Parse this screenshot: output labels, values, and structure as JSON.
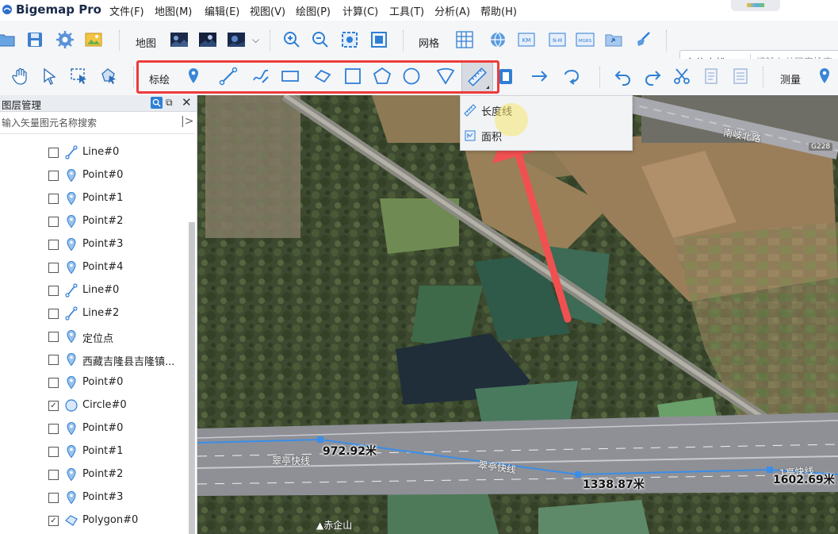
{
  "app": {
    "title": "Bigemap Pro"
  },
  "menu": [
    "文件(F)",
    "地图(M)",
    "编辑(E)",
    "视图(V)",
    "绘图(P)",
    "计算(C)",
    "工具(T)",
    "分析(A)",
    "帮助(H)"
  ],
  "toolbar1": {
    "map_label": "地图",
    "grid_label": "网格",
    "search_type": "定位查找",
    "search_placeholder": "请输入关键字检索"
  },
  "toolbar2": {
    "draw_label": "标绘",
    "measure_label": "测量"
  },
  "dropdown": {
    "items": [
      "长度线",
      "面积"
    ]
  },
  "sidebar": {
    "title": "图层管理",
    "search_placeholder": "输入矢量图元名称搜索",
    "layers": [
      {
        "name": "Line#0",
        "type": "line",
        "checked": false
      },
      {
        "name": "Point#0",
        "type": "point",
        "checked": false
      },
      {
        "name": "Point#1",
        "type": "point",
        "checked": false
      },
      {
        "name": "Point#2",
        "type": "point",
        "checked": false
      },
      {
        "name": "Point#3",
        "type": "point",
        "checked": false
      },
      {
        "name": "Point#4",
        "type": "point",
        "checked": false
      },
      {
        "name": "Line#0",
        "type": "line",
        "checked": false
      },
      {
        "name": "Line#2",
        "type": "line",
        "checked": false
      },
      {
        "name": "定位点",
        "type": "point",
        "checked": false
      },
      {
        "name": "西藏吉隆县吉隆镇...",
        "type": "point",
        "checked": false
      },
      {
        "name": "Point#0",
        "type": "point",
        "checked": false
      },
      {
        "name": "Circle#0",
        "type": "circle",
        "checked": true
      },
      {
        "name": "Point#0",
        "type": "point",
        "checked": false
      },
      {
        "name": "Point#1",
        "type": "point",
        "checked": false
      },
      {
        "name": "Point#2",
        "type": "point",
        "checked": false
      },
      {
        "name": "Point#3",
        "type": "point",
        "checked": false
      },
      {
        "name": "Polygon#0",
        "type": "polygon",
        "checked": true
      }
    ]
  },
  "map": {
    "road_labels": [
      "南岐北路",
      "G228",
      "翠亭快线",
      "翠亭快线",
      "1亭快线",
      "赤企山"
    ],
    "measurements": [
      "972.92米",
      "1338.87米",
      "1602.69米"
    ]
  },
  "colors": {
    "accent": "#2f7fd6",
    "highlight": "#ef3b3b",
    "arrow": "#f05050"
  }
}
